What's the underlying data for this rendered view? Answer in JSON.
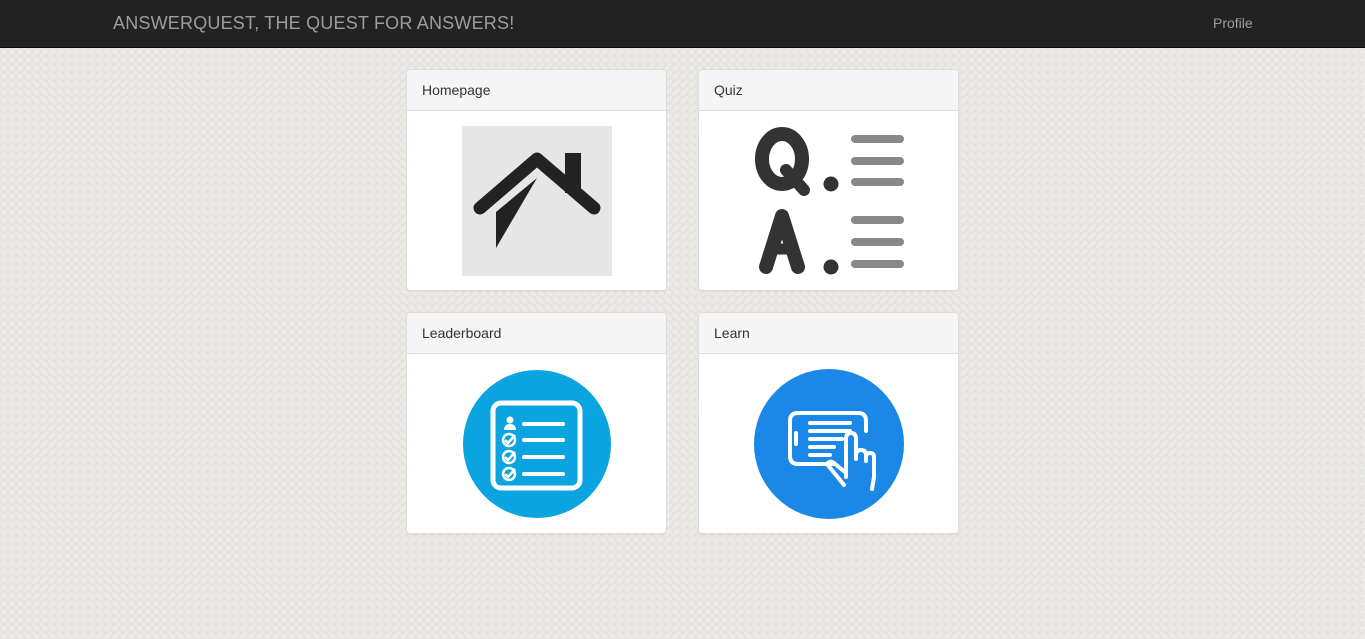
{
  "navbar": {
    "brand": "ANSWERQUEST, THE QUEST FOR ANSWERS!",
    "profile_link": "Profile",
    "background": "#222222",
    "text_color": "#9d9d9d"
  },
  "panels": [
    {
      "title": "Homepage",
      "icon": "house-icon"
    },
    {
      "title": "Quiz",
      "icon": "qa-icon"
    },
    {
      "title": "Leaderboard",
      "icon": "checklist-icon"
    },
    {
      "title": "Learn",
      "icon": "tablet-touch-icon"
    }
  ],
  "colors": {
    "leaderboard_circle": "#0aa5e0",
    "learn_circle": "#1b87e6",
    "house_bg": "#e6e6e6",
    "icon_dark": "#222222",
    "qa_lines": "#888888"
  }
}
